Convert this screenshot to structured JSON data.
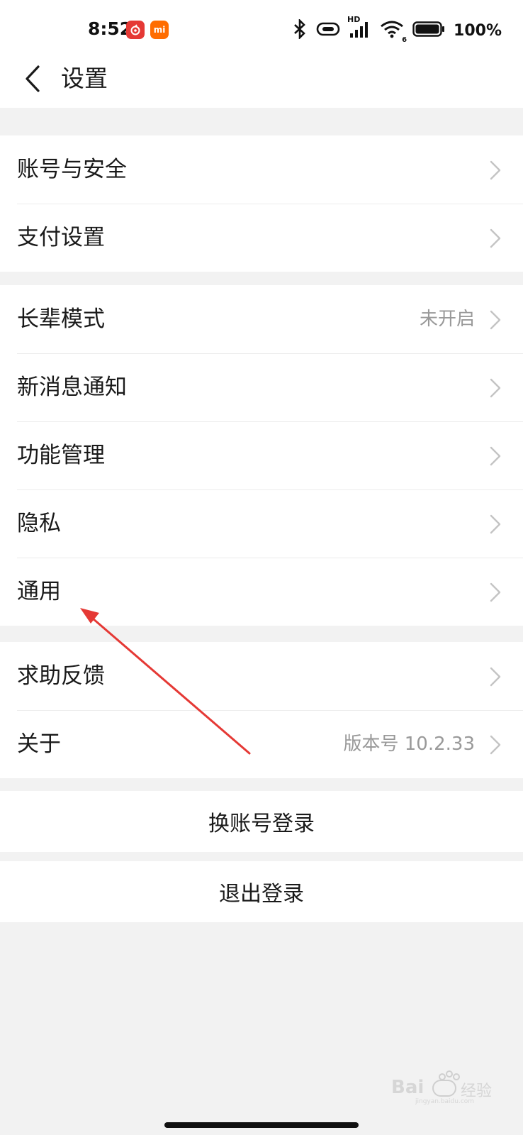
{
  "status_bar": {
    "time": "8:52",
    "app_badges": [
      {
        "name": "netease-music-icon",
        "color": "#e53935"
      },
      {
        "name": "mi-icon",
        "color": "#ff6d00",
        "label": "mi"
      }
    ],
    "network_label": "HD",
    "wifi_label": "6",
    "battery": "100%",
    "battery_level": 1.0
  },
  "header": {
    "title": "设置"
  },
  "groups": [
    {
      "items": [
        {
          "label": "账号与安全",
          "value": ""
        },
        {
          "label": "支付设置",
          "value": ""
        }
      ]
    },
    {
      "items": [
        {
          "label": "长辈模式",
          "value": "未开启"
        },
        {
          "label": "新消息通知",
          "value": ""
        },
        {
          "label": "功能管理",
          "value": ""
        },
        {
          "label": "隐私",
          "value": ""
        },
        {
          "label": "通用",
          "value": ""
        }
      ]
    },
    {
      "items": [
        {
          "label": "求助反馈",
          "value": ""
        },
        {
          "label": "关于",
          "value": "版本号 10.2.33"
        }
      ]
    }
  ],
  "actions": {
    "switch_account": "换账号登录",
    "logout": "退出登录"
  },
  "annotation": {
    "arrow_color": "#e53935"
  },
  "watermark": {
    "brand": "Bai",
    "suffix": "经验",
    "url": "jingyan.baidu.com"
  },
  "colors": {
    "background": "#f2f2f2",
    "surface": "#ffffff",
    "text": "#1a1a1a",
    "secondary_text": "#999999",
    "chevron": "#c4c4c4"
  }
}
